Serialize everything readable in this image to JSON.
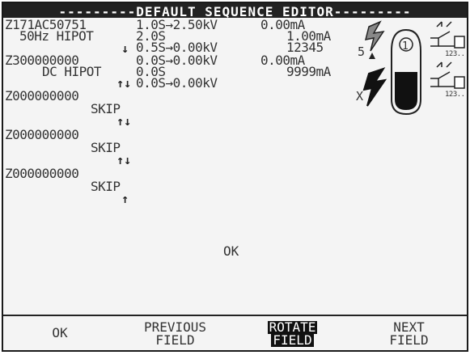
{
  "title": "DEFAULT SEQUENCE EDITOR",
  "steps": [
    {
      "code": "Z171AC50751",
      "name": "50Hz HIPOT",
      "arrow": "↓",
      "params": [
        "1.0S→2.50kV",
        "2.0S",
        "0.5S→0.00kV"
      ],
      "readings": [
        "0.00mA",
        "1.00mA",
        "12345"
      ]
    },
    {
      "code": "Z300000000",
      "name": "DC HIPOT",
      "arrow": "↑↓",
      "params": [
        "0.0S→0.00kV",
        "0.0S",
        "0.0S→0.00kV"
      ],
      "readings": [
        "0.00mA",
        "9999mA"
      ]
    },
    {
      "code": "Z000000000",
      "name": "SKIP",
      "arrow": "↑↓"
    },
    {
      "code": "Z000000000",
      "name": "SKIP",
      "arrow": "↑↓"
    },
    {
      "code": "Z000000000",
      "name": "SKIP",
      "arrow": "↑"
    }
  ],
  "panel": {
    "count_label": "5",
    "x_label": "X",
    "step_number": "1",
    "sequence_label_top": "123..",
    "sequence_label_bottom": "123.."
  },
  "status_message": "OK",
  "softkeys": {
    "ok": "OK",
    "previous_line1": "PREVIOUS",
    "previous_line2": "FIELD",
    "rotate_line1": "ROTATE",
    "rotate_line2": "FIELD",
    "next_line1": "NEXT",
    "next_line2": "FIELD"
  }
}
